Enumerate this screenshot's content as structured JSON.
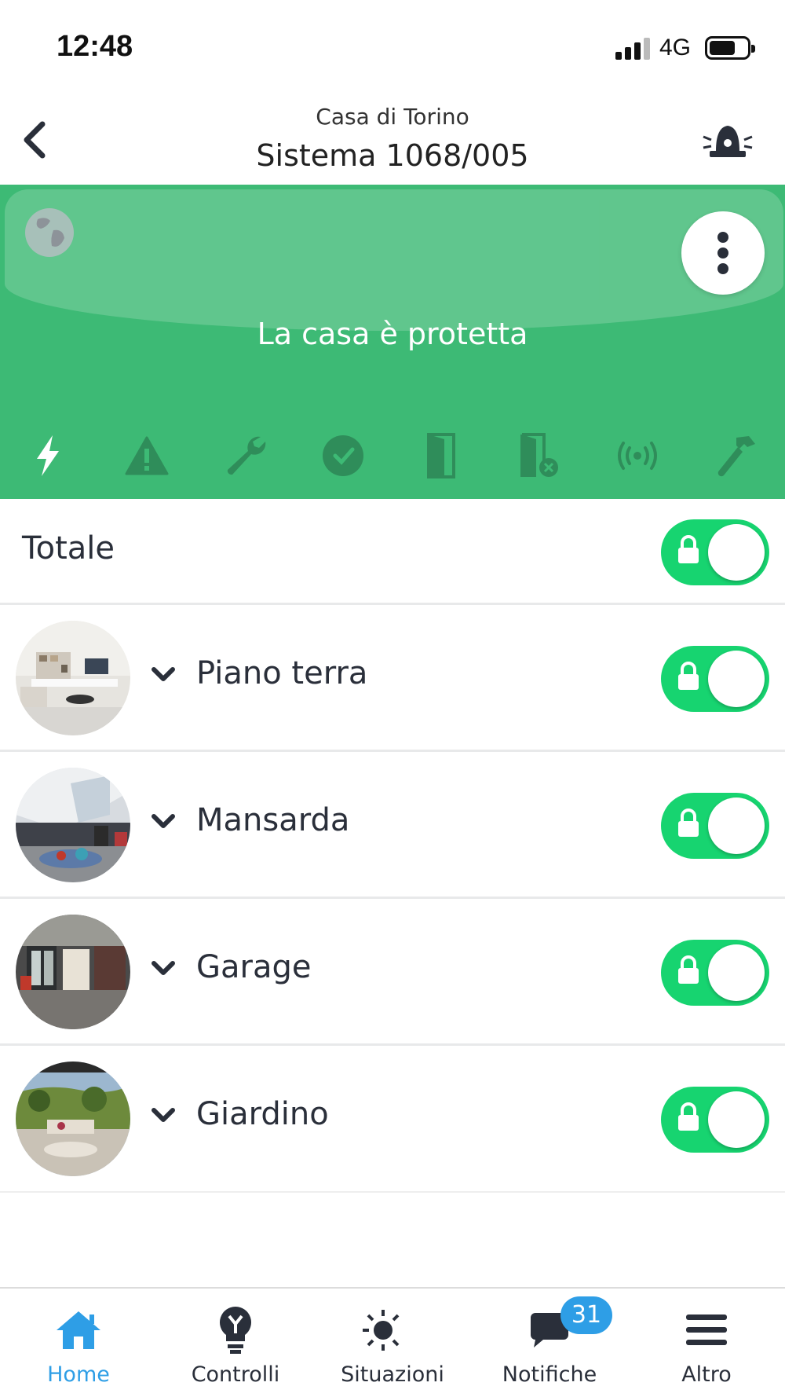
{
  "status_bar": {
    "time": "12:48",
    "network": "4G",
    "battery_level": 0.7
  },
  "header": {
    "subtitle": "Casa di Torino",
    "title": "Sistema 1068/005"
  },
  "panel": {
    "message": "La casa è protetta",
    "color": "#3dba75",
    "icons": [
      "lightning-icon",
      "warning-icon",
      "wrench-icon",
      "clock-icon",
      "door-icon",
      "door-excluded-icon",
      "signal-broadcast-icon",
      "hammer-icon"
    ]
  },
  "total": {
    "label": "Totale",
    "armed": true
  },
  "zones": [
    {
      "name": "Piano terra",
      "armed": true
    },
    {
      "name": "Mansarda",
      "armed": true
    },
    {
      "name": "Garage",
      "armed": true
    },
    {
      "name": "Giardino",
      "armed": true
    }
  ],
  "toggle_color": "#17d470",
  "tabs": [
    {
      "label": "Home",
      "icon": "home-icon",
      "active": true
    },
    {
      "label": "Controlli",
      "icon": "lightbulb-icon",
      "active": false
    },
    {
      "label": "Situazioni",
      "icon": "sun-moon-icon",
      "active": false
    },
    {
      "label": "Notifiche",
      "icon": "chat-icon",
      "active": false,
      "badge": "31"
    },
    {
      "label": "Altro",
      "icon": "menu-icon",
      "active": false
    }
  ],
  "accent": "#2e9ee6"
}
